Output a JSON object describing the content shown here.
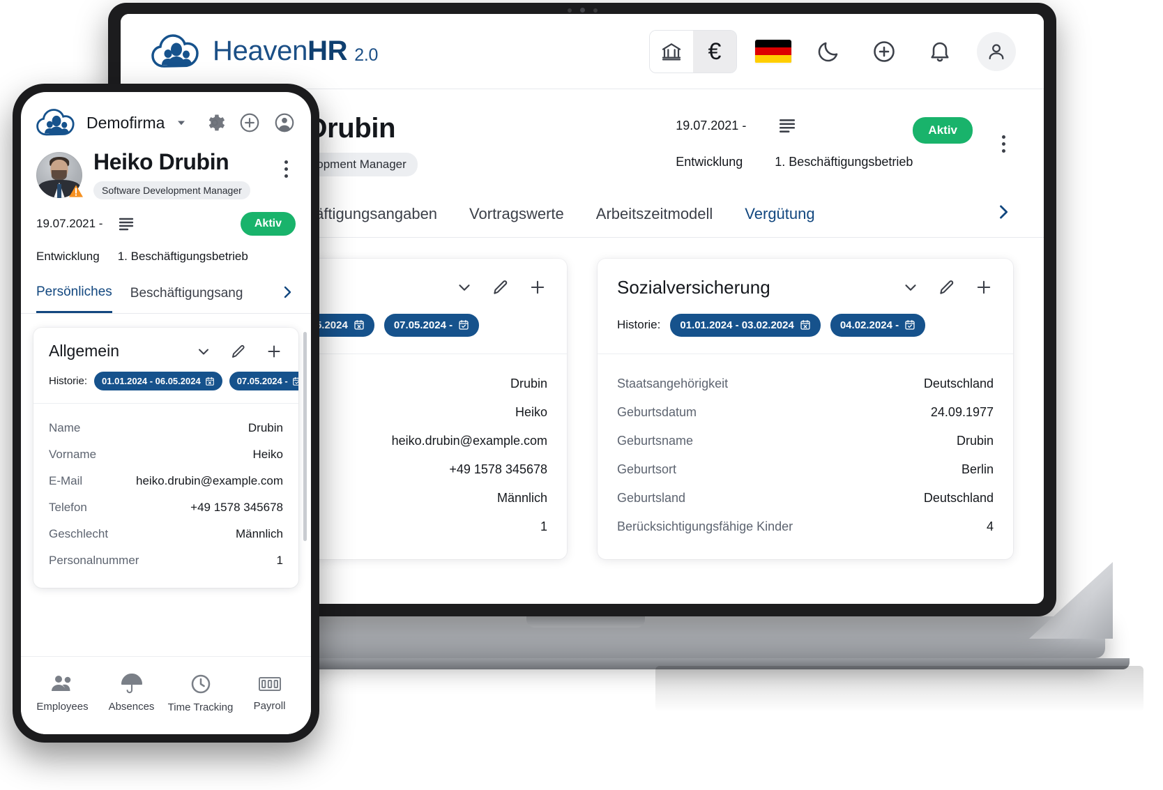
{
  "brand": {
    "name_light": "Heaven",
    "name_bold": "HR",
    "version": "2.0",
    "logo_icon": "cloud-people-logo"
  },
  "header": {
    "segmented": [
      {
        "icon": "bank-icon",
        "label": "",
        "active": false
      },
      {
        "icon": "euro-icon",
        "label": "€",
        "active": true
      }
    ],
    "flag_icon": "german-flag-icon",
    "flag_colors": [
      "#000000",
      "#dd0000",
      "#ffce00"
    ],
    "dark_mode_icon": "moon-icon",
    "add_icon": "plus-circle-icon",
    "notification_icon": "bell-icon",
    "account_icon": "user-avatar-icon"
  },
  "employee": {
    "name": "Heiko Drubin",
    "role": "Software Development Manager",
    "photo_icon": "employee-photo",
    "warning_icon": "warning-triangle-icon",
    "date_range": "19.07.2021 -",
    "history_icon": "history-lines-icon",
    "department": "Entwicklung",
    "company": "1. Beschäftigungsbetrieb",
    "status": "Aktiv",
    "status_color": "#19b36b",
    "menu_icon": "kebab-menu-icon"
  },
  "tabs": {
    "items": [
      {
        "label": "Persönliches",
        "active": true
      },
      {
        "label": "Beschäftigungsangaben",
        "active": false
      },
      {
        "label": "Vortragswerte",
        "active": false
      },
      {
        "label": "Arbeitszeitmodell",
        "active": false
      },
      {
        "label": "Vergütung",
        "active": false,
        "accent": true
      }
    ],
    "next_icon": "chevron-right-icon"
  },
  "cards": [
    {
      "title": "Allgemein",
      "collapse_icon": "chevron-down-icon",
      "edit_icon": "pencil-icon",
      "add_icon": "plus-icon",
      "history_label": "Historie:",
      "history_chips": [
        {
          "label": "01.01.2024 - 06.05.2024",
          "icon": "calendar-x-icon"
        },
        {
          "label": "07.05.2024 -",
          "icon": "calendar-check-icon"
        }
      ],
      "rows": [
        {
          "key": "Name",
          "value": "Drubin"
        },
        {
          "key": "Vorname",
          "value": "Heiko"
        },
        {
          "key": "E-Mail",
          "value": "heiko.drubin@example.com"
        },
        {
          "key": "Telefon",
          "value": "+49 1578 345678"
        },
        {
          "key": "Geschlecht",
          "value": "Männlich"
        },
        {
          "key": "Personalnummer",
          "value": "1"
        }
      ]
    },
    {
      "title": "Sozialversicherung",
      "collapse_icon": "chevron-down-icon",
      "edit_icon": "pencil-icon",
      "add_icon": "plus-icon",
      "history_label": "Historie:",
      "history_chips": [
        {
          "label": "01.01.2024 - 03.02.2024",
          "icon": "calendar-x-icon"
        },
        {
          "label": "04.02.2024 -",
          "icon": "calendar-check-icon"
        }
      ],
      "rows": [
        {
          "key": "Staatsangehörigkeit",
          "value": "Deutschland"
        },
        {
          "key": "Geburtsdatum",
          "value": "24.09.1977"
        },
        {
          "key": "Geburtsname",
          "value": "Drubin"
        },
        {
          "key": "Geburtsort",
          "value": "Berlin"
        },
        {
          "key": "Geburtsland",
          "value": "Deutschland"
        },
        {
          "key": "Berücksichtigungsfähige Kinder",
          "value": "4"
        }
      ]
    }
  ],
  "phone": {
    "header": {
      "logo_icon": "cloud-people-logo",
      "company": "Demofirma",
      "company_chevron_icon": "chevron-down-icon",
      "settings_icon": "gear-icon",
      "add_icon": "plus-circle-icon",
      "account_icon": "user-avatar-icon"
    },
    "employee": {
      "name": "Heiko Drubin",
      "role": "Software Development Manager",
      "date_range": "19.07.2021 -",
      "history_icon": "history-lines-icon",
      "department": "Entwicklung",
      "company": "1. Beschäftigungsbetrieb",
      "status": "Aktiv",
      "menu_icon": "kebab-menu-icon",
      "warning_icon": "warning-triangle-icon"
    },
    "tabs": {
      "items": [
        {
          "label": "Persönliches",
          "active": true
        },
        {
          "label": "Beschäftigungsang",
          "active": false
        }
      ],
      "next_icon": "chevron-right-icon"
    },
    "card": {
      "title": "Allgemein",
      "collapse_icon": "chevron-down-icon",
      "edit_icon": "pencil-icon",
      "add_icon": "plus-icon",
      "history_label": "Historie:",
      "history_chips": [
        {
          "label": "01.01.2024 - 06.05.2024",
          "icon": "calendar-x-icon"
        },
        {
          "label": "07.05.2024 -",
          "icon": "calendar-check-icon"
        }
      ],
      "rows": [
        {
          "key": "Name",
          "value": "Drubin"
        },
        {
          "key": "Vorname",
          "value": "Heiko"
        },
        {
          "key": "E-Mail",
          "value": "heiko.drubin@example.com"
        },
        {
          "key": "Telefon",
          "value": "+49 1578 345678"
        },
        {
          "key": "Geschlecht",
          "value": "Männlich"
        },
        {
          "key": "Personalnummer",
          "value": "1"
        }
      ]
    },
    "nav": [
      {
        "label": "Employees",
        "icon": "people-icon"
      },
      {
        "label": "Absences",
        "icon": "umbrella-icon"
      },
      {
        "label": "Time Tracking",
        "icon": "clock-icon"
      },
      {
        "label": "Payroll",
        "icon": "money-icon"
      }
    ]
  },
  "colors": {
    "brand_blue": "#1b4f86",
    "chip_blue": "#16528c",
    "active_green": "#19b36b",
    "text_dark": "#15181d",
    "text_muted": "#5d6470"
  }
}
